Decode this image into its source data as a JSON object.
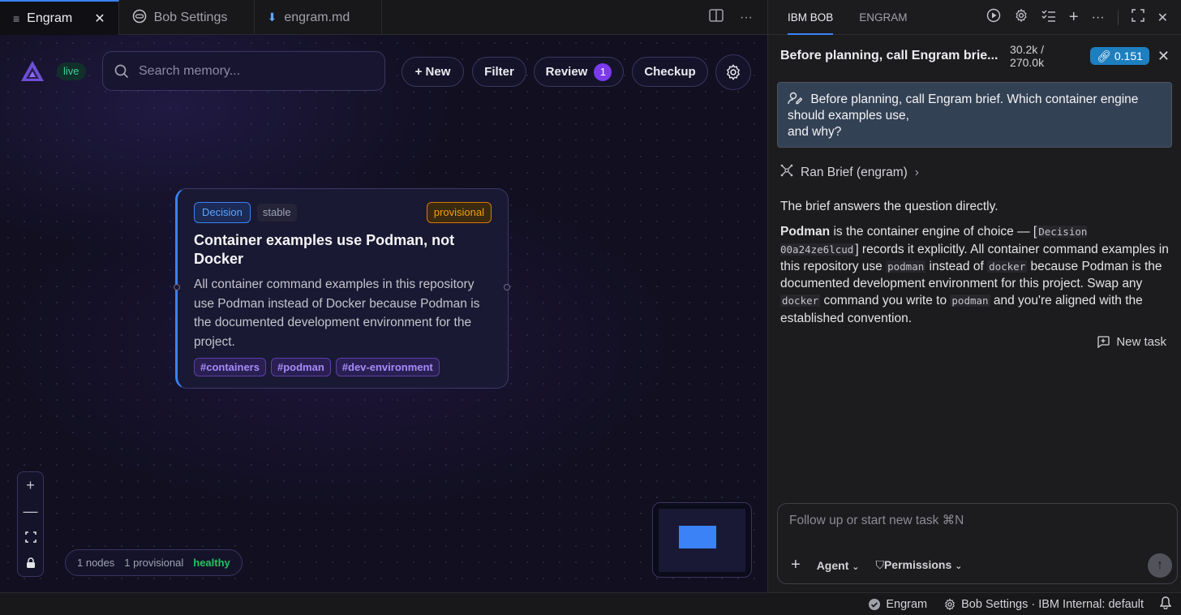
{
  "tabs": [
    {
      "label": "Engram",
      "icon": "menu-lines-icon",
      "active": true
    },
    {
      "label": "Bob Settings",
      "icon": "robot-icon",
      "active": false
    },
    {
      "label": "engram.md",
      "icon": "markdown-down-arrow-icon",
      "active": false
    }
  ],
  "canvas": {
    "live_label": "live",
    "search_placeholder": "Search memory...",
    "buttons": {
      "new": "+ New",
      "filter": "Filter",
      "review": "Review",
      "review_count": "1",
      "checkup": "Checkup"
    },
    "card": {
      "type_tag": "Decision",
      "stability_tag": "stable",
      "status_tag": "provisional",
      "title": "Container examples use Podman, not Docker",
      "body": "All container command examples in this repository use Podman instead of Docker because Podman is the documented development environment for the project.",
      "hashtags": [
        "#containers",
        "#podman",
        "#dev-environment"
      ]
    },
    "status": {
      "nodes": "1 nodes",
      "provisional": "1 provisional",
      "health": "healthy"
    }
  },
  "panel": {
    "tabs": [
      {
        "label": "IBM BOB",
        "active": true
      },
      {
        "label": "ENGRAM",
        "active": false
      }
    ],
    "task_title": "Before planning, call Engram brie...",
    "tokens": "30.2k / 270.0k",
    "cost": "0.151",
    "prompt_line1": "Before planning, call Engram brief. Which container engine should examples use,",
    "prompt_line2": "and why?",
    "tool_call": "Ran Brief (engram)",
    "answer_intro": "The brief answers the question directly.",
    "answer": {
      "bold": "Podman",
      "t1": " is the container engine of choice — [",
      "code1": "Decision 00a24ze6lcud",
      "t2": "] records it explicitly. All container command examples in this repository use ",
      "code2": "podman",
      "t3": " instead of ",
      "code3": "docker",
      "t4": " because Podman is the documented development environment for this project. Swap any ",
      "code4": "docker",
      "t5": " command you write to ",
      "code5": "podman",
      "t6": " and you're aligned with the established convention."
    },
    "new_task_label": "New task",
    "composer_placeholder": "Follow up or start new task ⌘N",
    "agent_label": "Agent",
    "permissions_label": "Permissions"
  },
  "statusbar": {
    "engram": "Engram",
    "settings": "Bob Settings · IBM Internal: default"
  },
  "colors": {
    "accent": "#3b82f6",
    "live": "#34d399",
    "provisional": "#f59e0b",
    "hashtag": "#a78bfa",
    "healthy": "#22c55e",
    "cost_badge": "#1e7fbf"
  }
}
